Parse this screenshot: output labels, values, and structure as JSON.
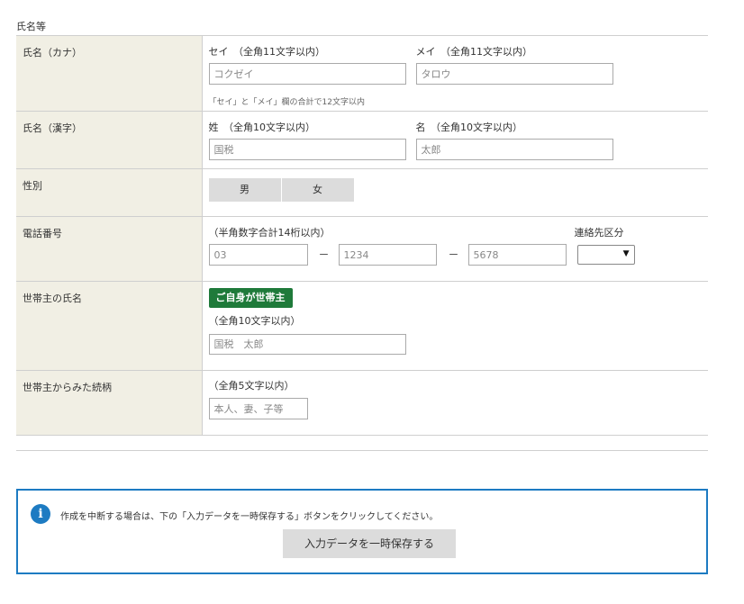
{
  "section": {
    "title": "氏名等"
  },
  "kana": {
    "row_label": "氏名（カナ）",
    "sei_label": "セイ　（全角11文字以内）",
    "mei_label": "メイ　（全角11文字以内）",
    "sei_placeholder": "コクゼイ",
    "mei_placeholder": "タロウ",
    "note": "「セイ」と「メイ」欄の合計で12文字以内"
  },
  "kanji": {
    "row_label": "氏名（漢字）",
    "sei_label": "姓　（全角10文字以内）",
    "mei_label": "名　（全角10文字以内）",
    "sei_placeholder": "国税",
    "mei_placeholder": "太郎"
  },
  "gender": {
    "row_label": "性別",
    "options": [
      "男",
      "女"
    ]
  },
  "phone": {
    "row_label": "電話番号",
    "hint": "（半角数字合計14桁以内）",
    "part1_placeholder": "03",
    "part2_placeholder": "1234",
    "part3_placeholder": "5678",
    "separator": "－",
    "contact_type_label": "連絡先区分",
    "contact_type_value": "",
    "dropdown_arrow": "▼"
  },
  "householder": {
    "row_label": "世帯主の氏名",
    "self_button": "ご自身が世帯主",
    "hint": "（全角10文字以内）",
    "placeholder": "国税　太郎"
  },
  "relation": {
    "row_label": "世帯主からみた続柄",
    "hint": "（全角5文字以内）",
    "placeholder": "本人、妻、子等"
  },
  "info": {
    "icon": "info-icon",
    "icon_glyph": "i",
    "message": "作成を中断する場合は、下の「入力データを一時保存する」ボタンをクリックしてください。",
    "save_button": "入力データを一時保存する"
  },
  "colors": {
    "label_bg": "#f1efe4",
    "accent_green": "#1f7a3a",
    "info_blue": "#1d7bc2",
    "button_gray": "#dcdcdc"
  }
}
